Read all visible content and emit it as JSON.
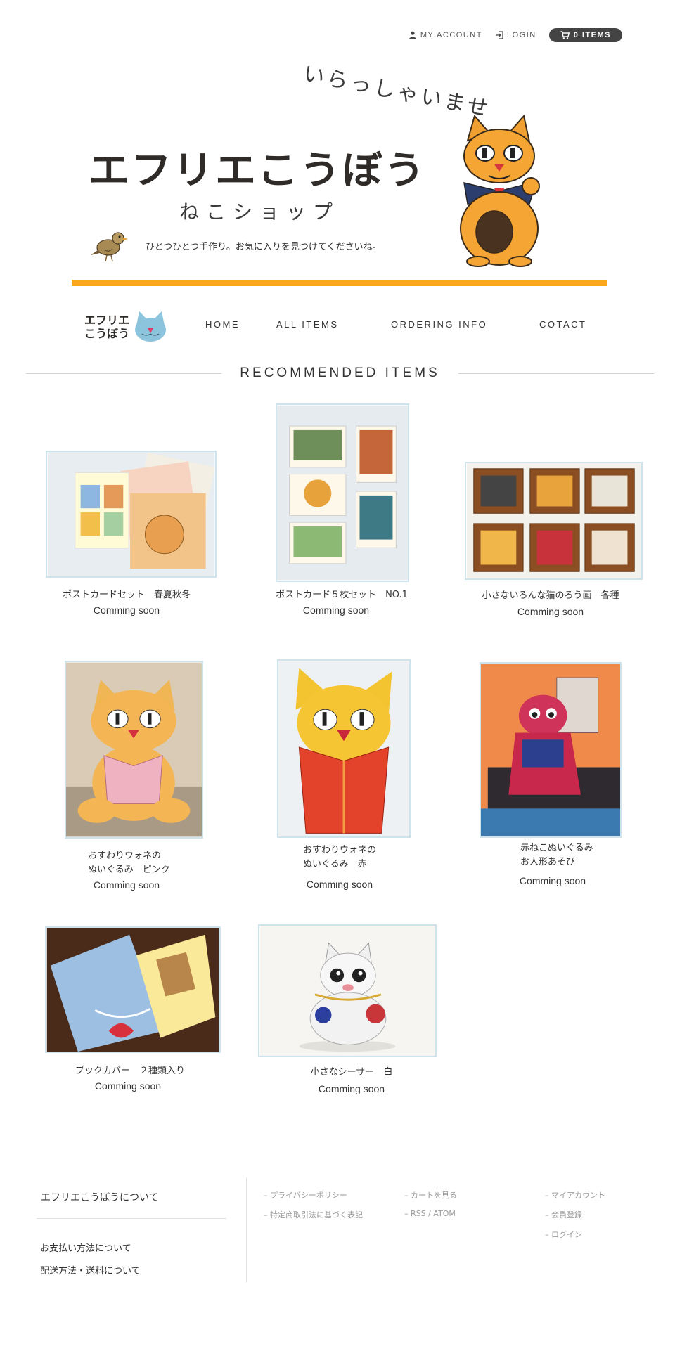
{
  "topbar": {
    "my_account": "MY ACCOUNT",
    "login": "LOGIN",
    "cart": "0 ITEMS"
  },
  "banner": {
    "title": "エフリエこうぼう",
    "greeting": "いらっしゃいませ",
    "subtitle": "ねこショップ",
    "tagline": "ひとつひとつ手作り。お気に入りを見つけてくださいね。"
  },
  "nav": {
    "logo_line1": "エフリエ",
    "logo_line2": "こうぼう",
    "items": [
      "HOME",
      "ALL ITEMS",
      "ORDERING INFO",
      "COTACT"
    ]
  },
  "section": {
    "heading": "RECOMMENDED ITEMS"
  },
  "products": [
    {
      "name": "ポストカードセット　春夏秋冬",
      "status": "Comming soon"
    },
    {
      "name": "ポストカード５枚セット　NO.1",
      "status": "Comming soon"
    },
    {
      "name": "小さないろんな猫のろう画　各種",
      "status": "Comming soon"
    },
    {
      "name": "おすわりウォネの\nぬいぐるみ　ピンク",
      "status": "Comming soon"
    },
    {
      "name": "おすわりウォネの\nぬいぐるみ　赤",
      "status": "Comming soon"
    },
    {
      "name": "赤ねこぬいぐるみ\nお人形あそび",
      "status": "Comming soon"
    },
    {
      "name": "ブックカバー　２種類入り",
      "status": "Comming soon"
    },
    {
      "name": "小さなシーサー　白",
      "status": "Comming soon"
    }
  ],
  "footer": {
    "about": "エフリエこうぼうについて",
    "left_links": [
      "お支払い方法について",
      "配送方法・送料について"
    ],
    "col1": [
      "プライバシーポリシー",
      "特定商取引法に基づく表記"
    ],
    "col2": [
      "カートを見る",
      "RSS / ATOM"
    ],
    "col3": [
      "マイアカウント",
      "会員登録",
      "ログイン"
    ]
  },
  "colors": {
    "accent_bar": "#f9a81b",
    "cart_pill": "#444444",
    "thumb_border": "#cfe3ec"
  }
}
